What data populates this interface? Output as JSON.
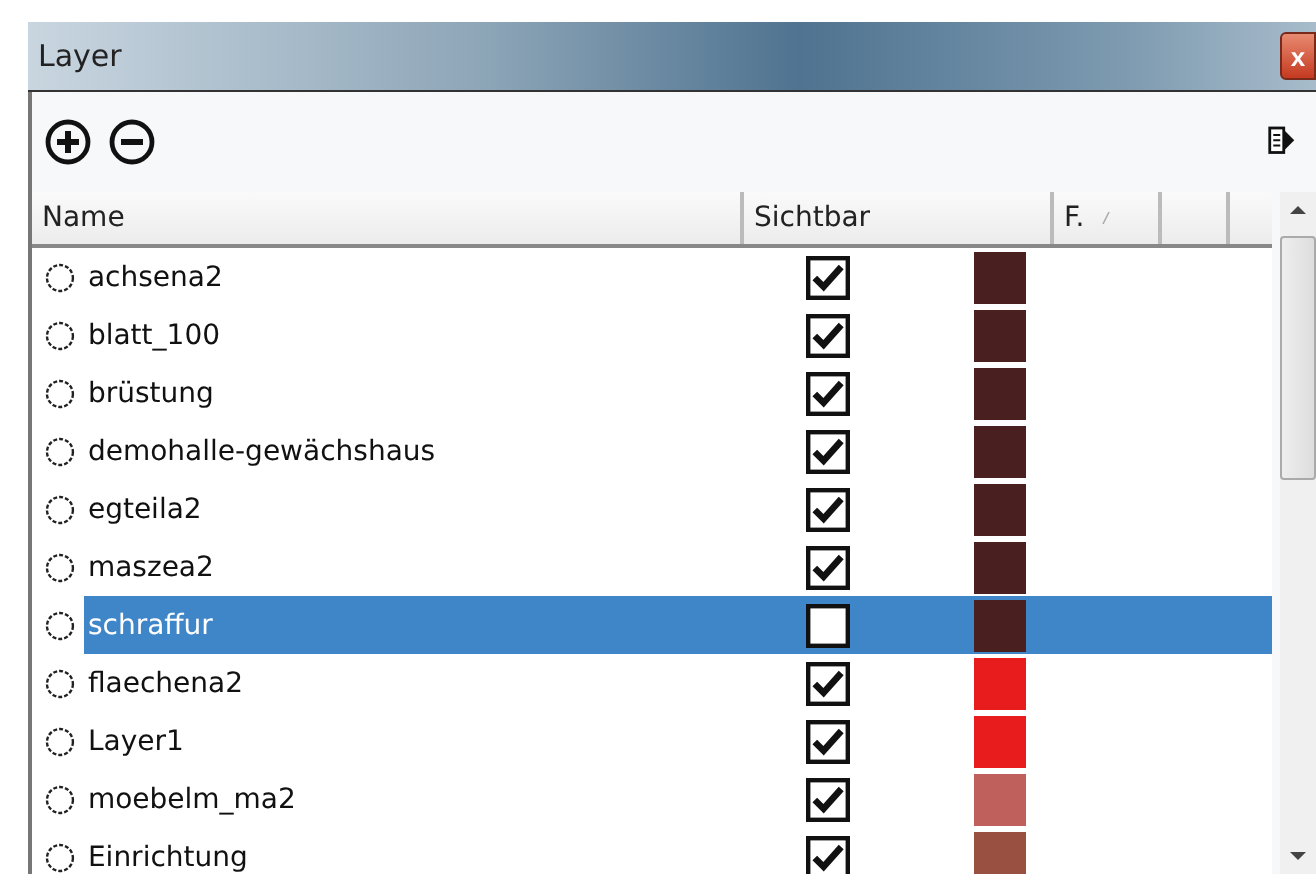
{
  "window": {
    "title": "Layer",
    "close": "x"
  },
  "columns": [
    "Name",
    "Sichtbar",
    "F."
  ],
  "layers": [
    {
      "name": "achsena2",
      "active": false,
      "visible": true,
      "color": "#4a1f1f",
      "selected": false
    },
    {
      "name": "blatt_100",
      "active": false,
      "visible": true,
      "color": "#4a1f1f",
      "selected": false
    },
    {
      "name": "brüstung",
      "active": false,
      "visible": true,
      "color": "#4a1f1f",
      "selected": false
    },
    {
      "name": "demohalle-gewächshaus",
      "active": false,
      "visible": true,
      "color": "#4a1f1f",
      "selected": false
    },
    {
      "name": "egteila2",
      "active": false,
      "visible": true,
      "color": "#4a1f1f",
      "selected": false
    },
    {
      "name": "maszea2",
      "active": false,
      "visible": true,
      "color": "#4a1f1f",
      "selected": false
    },
    {
      "name": "schraffur",
      "active": false,
      "visible": false,
      "color": "#4a1f1f",
      "selected": true
    },
    {
      "name": "flaechena2",
      "active": false,
      "visible": true,
      "color": "#e81c1c",
      "selected": false
    },
    {
      "name": "Layer1",
      "active": false,
      "visible": true,
      "color": "#e81c1c",
      "selected": false
    },
    {
      "name": "moebelm_ma2",
      "active": false,
      "visible": true,
      "color": "#c0605c",
      "selected": false
    },
    {
      "name": "Einrichtung",
      "active": false,
      "visible": true,
      "color": "#9a5040",
      "selected": false
    }
  ]
}
